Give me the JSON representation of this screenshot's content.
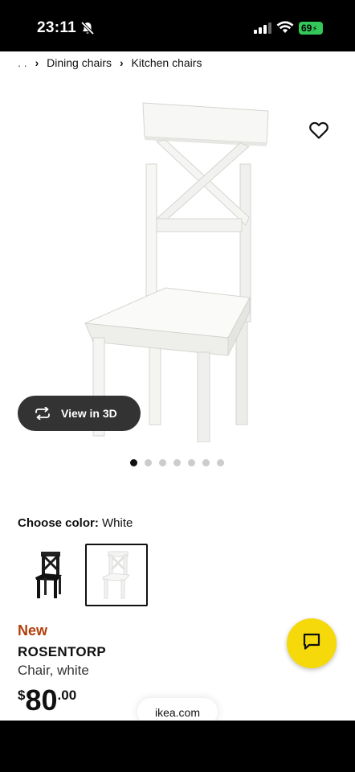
{
  "status_bar": {
    "time": "23:11",
    "battery": "69"
  },
  "breadcrumb": {
    "ellipsis": ". .",
    "separator": "›",
    "items": [
      "Dining chairs",
      "Kitchen chairs"
    ]
  },
  "gallery": {
    "view_3d_label": "View in 3D",
    "dot_count": 7,
    "active_dot": 0
  },
  "color": {
    "label": "Choose color:",
    "selected": "White",
    "options": [
      "black",
      "white"
    ]
  },
  "product": {
    "badge": "New",
    "name": "ROSENTORP",
    "description": "Chair, white",
    "price": {
      "currency": "$",
      "integer": "80",
      "decimal": ".00"
    }
  },
  "browser": {
    "url": "ikea.com"
  },
  "colors": {
    "badge_new": "#b23e0a",
    "chat_button": "#f5d90a",
    "view3d_bg": "#333333",
    "battery": "#34c759"
  }
}
